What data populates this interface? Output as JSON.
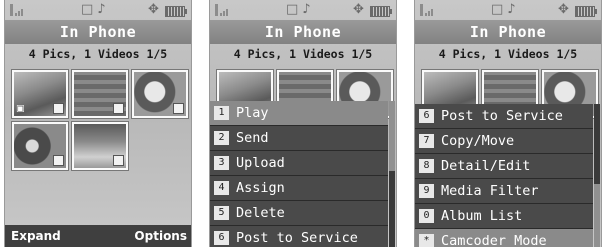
{
  "screen1": {
    "title": "In Phone",
    "subtitle": "4 Pics, 1 Videos 1/5",
    "soft_left": "Expand",
    "soft_right": "Options",
    "thumbnails": [
      "video-thumbnail",
      "photo-thumbnail",
      "photo-thumbnail",
      "photo-thumbnail",
      "photo-thumbnail"
    ]
  },
  "screen2": {
    "title": "In Phone",
    "subtitle": "4 Pics, 1 Videos 1/5",
    "menu": [
      {
        "key": "1",
        "label": "Play"
      },
      {
        "key": "2",
        "label": "Send"
      },
      {
        "key": "3",
        "label": "Upload"
      },
      {
        "key": "4",
        "label": "Assign"
      },
      {
        "key": "5",
        "label": "Delete"
      },
      {
        "key": "6",
        "label": "Post to Service"
      }
    ]
  },
  "screen3": {
    "title": "In Phone",
    "subtitle": "4 Pics, 1 Videos 1/5",
    "menu": [
      {
        "key": "6",
        "label": "Post to Service"
      },
      {
        "key": "7",
        "label": "Copy/Move"
      },
      {
        "key": "8",
        "label": "Detail/Edit"
      },
      {
        "key": "9",
        "label": "Media Filter"
      },
      {
        "key": "0",
        "label": "Album List"
      },
      {
        "key": "*",
        "label": "Camcoder Mode"
      }
    ]
  },
  "status_icons": [
    "signal-icon",
    "phone-icon",
    "music-note-icon",
    "network-icon",
    "battery-icon"
  ],
  "colors": {
    "title_bar": "#8c8c8c",
    "menu_bg": "#4a4a4a",
    "menu_selected": "#8a8a8a",
    "soft_bar": "#3f3f3f"
  }
}
